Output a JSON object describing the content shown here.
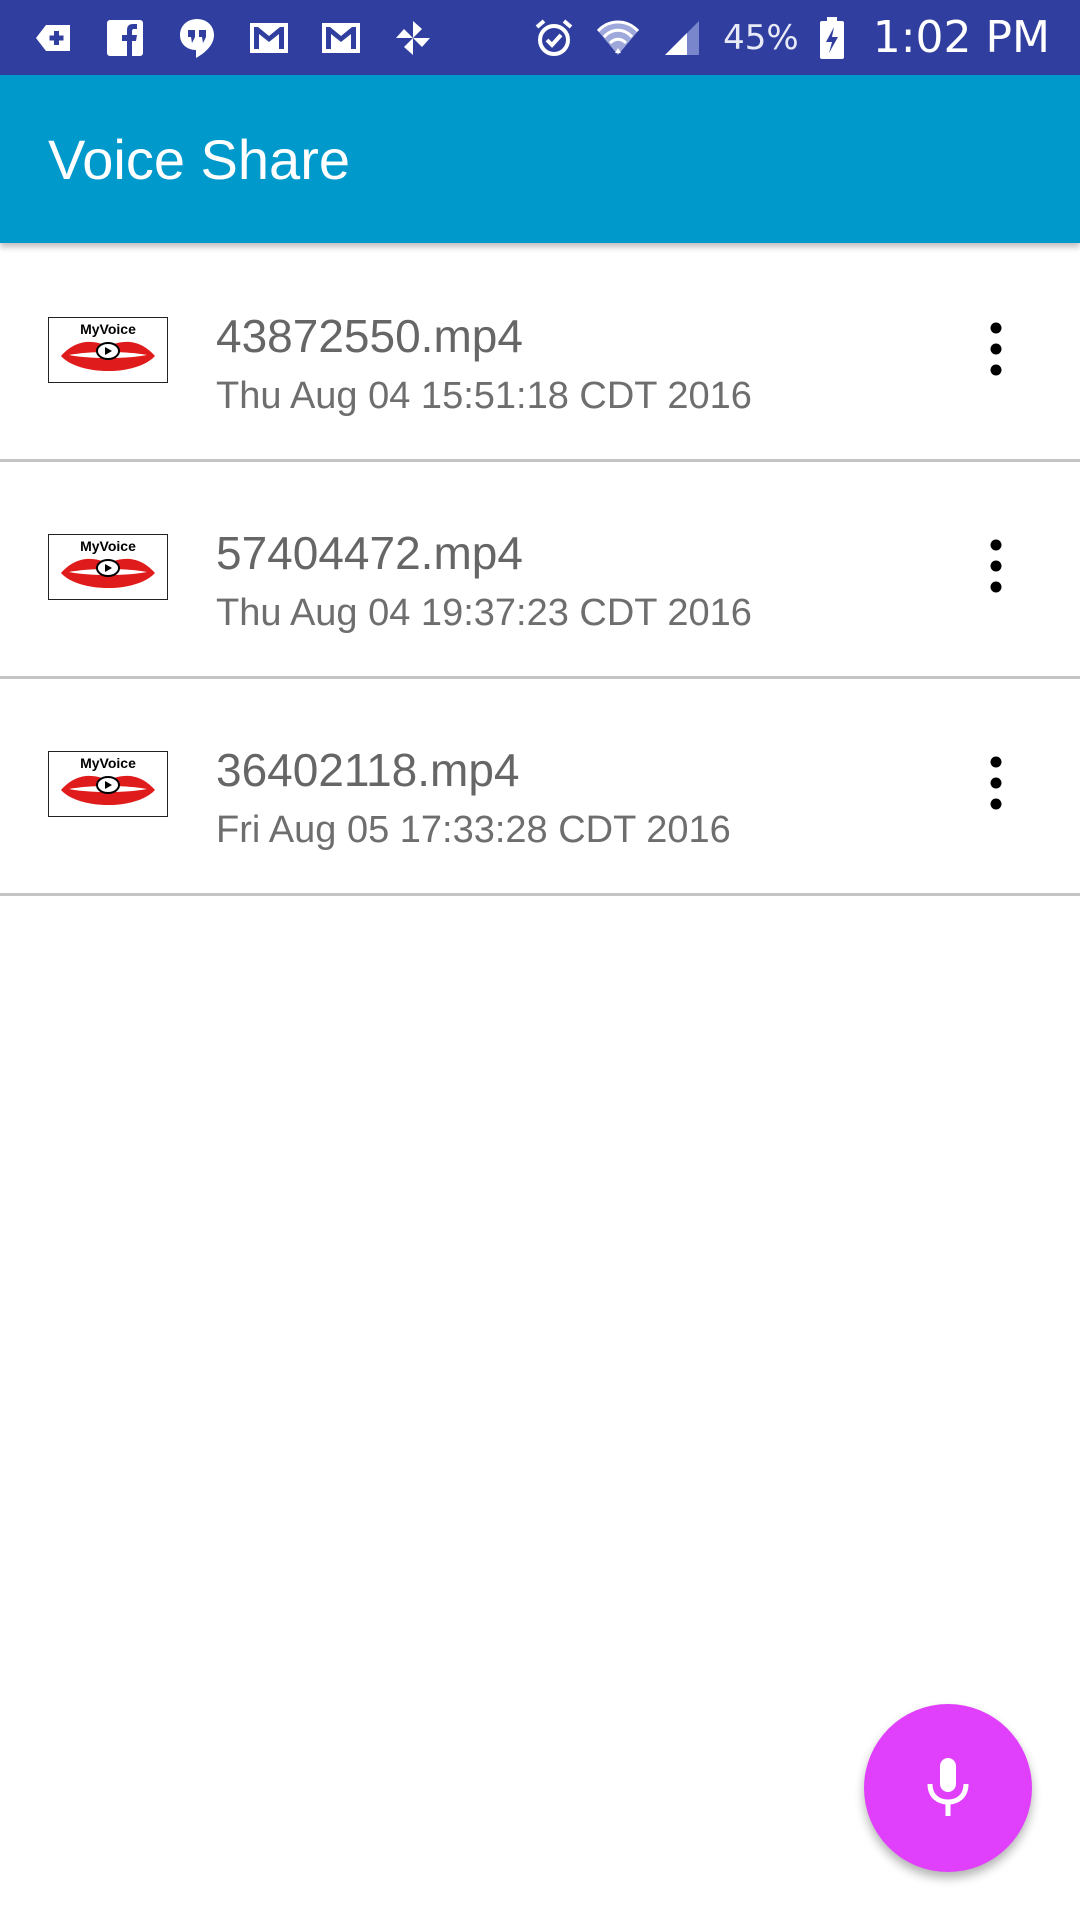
{
  "status_bar": {
    "notification_icons": [
      "add-icon",
      "facebook-icon",
      "hangouts-icon",
      "gmail-icon",
      "gmail-icon",
      "pinwheel-icon"
    ],
    "alarm_icon": "alarm-icon",
    "wifi_icon": "wifi-icon",
    "signal_icon": "signal-icon",
    "battery_percent": "45%",
    "battery_icon": "battery-charging-icon",
    "time": "1:02 PM",
    "background_color": "#303f9f"
  },
  "app_bar": {
    "title": "Voice Share",
    "background_color": "#0099cc"
  },
  "recordings": [
    {
      "thumbnail": {
        "logo_text": "MyVoice",
        "icon": "myvoice-lips-logo"
      },
      "file_name": "43872550.mp4",
      "date": "Thu Aug 04 15:51:18 CDT 2016",
      "menu_icon": "more-vert-icon"
    },
    {
      "thumbnail": {
        "logo_text": "MyVoice",
        "icon": "myvoice-lips-logo"
      },
      "file_name": "57404472.mp4",
      "date": "Thu Aug 04 19:37:23 CDT 2016",
      "menu_icon": "more-vert-icon"
    },
    {
      "thumbnail": {
        "logo_text": "MyVoice",
        "icon": "myvoice-lips-logo"
      },
      "file_name": "36402118.mp4",
      "date": "Fri Aug 05 17:33:28 CDT 2016",
      "menu_icon": "more-vert-icon"
    }
  ],
  "fab": {
    "icon": "microphone-icon",
    "background_color": "#e040fb"
  }
}
